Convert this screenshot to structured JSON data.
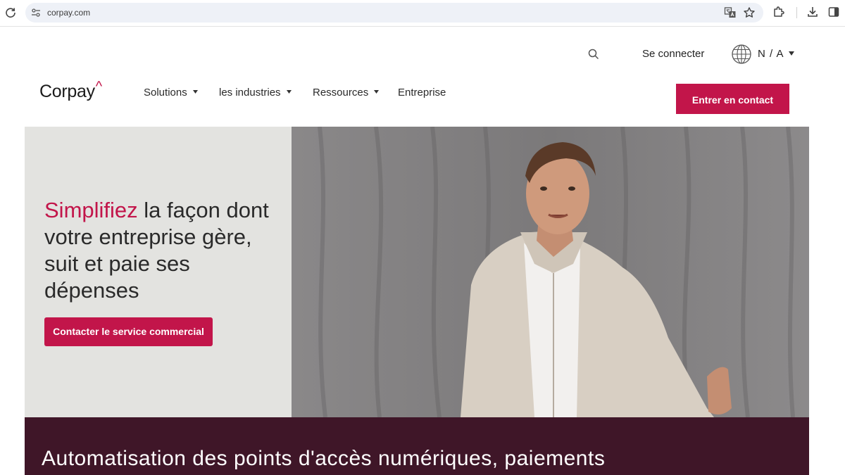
{
  "browser": {
    "url": "corpay.com"
  },
  "utility_nav": {
    "login_label": "Se connecter",
    "language_label": "N / A"
  },
  "header": {
    "logo_text": "Corpay",
    "logo_mark": "^",
    "nav_items": [
      {
        "label": "Solutions",
        "has_dropdown": true
      },
      {
        "label": "les industries",
        "has_dropdown": true
      },
      {
        "label": "Ressources",
        "has_dropdown": true
      },
      {
        "label": "Entreprise",
        "has_dropdown": false
      }
    ],
    "cta_label": "Entrer en contact"
  },
  "hero": {
    "title_accent": "Simplifiez",
    "title_rest": " la façon dont votre entreprise gère, suit et paie ses dépenses",
    "button_label": "Contacter le service commercial"
  },
  "section": {
    "title": "Automatisation des points d'accès numériques, paiements"
  },
  "colors": {
    "brand": "#c2154a",
    "hero_panel": "#e3e3e0",
    "dark_band": "#3f1628"
  },
  "icons": [
    "reload-icon",
    "site-info-icon",
    "translate-icon",
    "star-icon",
    "extensions-icon",
    "download-icon",
    "side-panel-icon",
    "search-icon",
    "globe-icon",
    "chevron-down-icon"
  ]
}
